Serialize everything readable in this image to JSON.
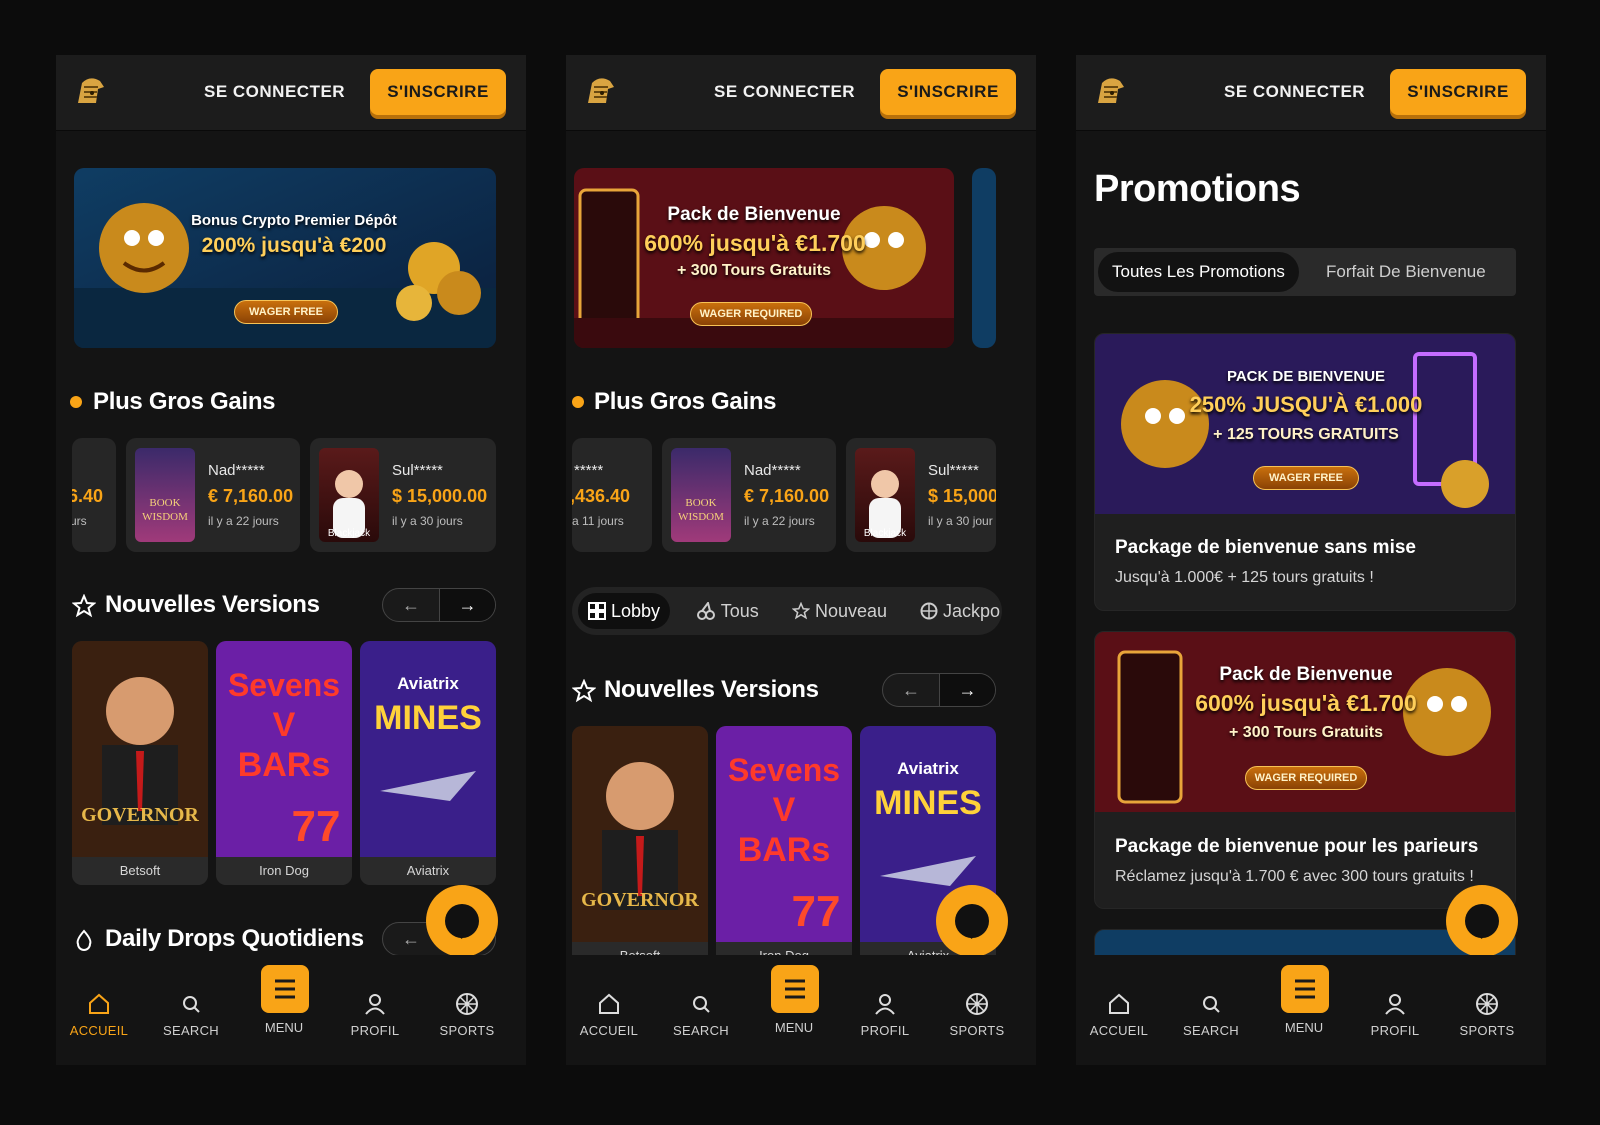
{
  "header": {
    "login_label": "SE CONNECTER",
    "signup_label": "S'INSCRIRE"
  },
  "banners": {
    "crypto": {
      "title": "Bonus Crypto Premier Dépôt",
      "line": "200% jusqu'à €200",
      "pill": "WAGER FREE"
    },
    "welcome": {
      "title": "Pack de Bienvenue",
      "line": "600% jusqu'à €1.700",
      "sub": "+ 300 Tours Gratuits",
      "pill": "WAGER REQUIRED"
    }
  },
  "biggest_wins": {
    "title": "Plus Gros Gains",
    "panel1": [
      {
        "user": "",
        "amount": "6.40",
        "time": "urs",
        "thumb": ""
      },
      {
        "user": "Nad*****",
        "amount": "€ 7,160.00",
        "time": "il y a 22 jours",
        "thumb": "Book of Wisdom"
      },
      {
        "user": "Sul*****",
        "amount": "$ 15,000.00",
        "time": "il y a 30 jours",
        "thumb": "Blackjack"
      }
    ],
    "panel2": [
      {
        "user": "*****",
        "amount": ",436.40",
        "time": "a 11 jours",
        "thumb": ""
      },
      {
        "user": "Nad*****",
        "amount": "€ 7,160.00",
        "time": "il y a 22 jours",
        "thumb": "Book of Wisdom"
      },
      {
        "user": "Sul*****",
        "amount": "$ 15,000",
        "time": "il y a 30 jour",
        "thumb": "Blackjack"
      }
    ]
  },
  "new_releases": {
    "title": "Nouvelles Versions",
    "prev_icon": "←",
    "next_icon": "→",
    "games": [
      {
        "name": "Betsoft",
        "art": "THE GOVERNOR"
      },
      {
        "name": "Iron Dog",
        "art": "Sevens V BARs"
      },
      {
        "name": "Aviatrix",
        "art": "Aviatrix MINES"
      }
    ]
  },
  "daily_drops": {
    "title": "Daily Drops Quotidiens"
  },
  "lobby_tabs": [
    {
      "label": "Lobby",
      "icon": "grid-icon"
    },
    {
      "label": "Tous",
      "icon": "cherries-icon"
    },
    {
      "label": "Nouveau",
      "icon": "star-icon"
    },
    {
      "label": "Jackpo",
      "icon": "coin-icon"
    }
  ],
  "promotions": {
    "title": "Promotions",
    "tabs": [
      "Toutes Les Promotions",
      "Forfait De Bienvenue"
    ],
    "cards": [
      {
        "banner_title": "PACK DE BIENVENUE",
        "banner_line": "250% JUSQU'À €1.000",
        "banner_sub": "+ 125 TOURS GRATUITS",
        "pill": "WAGER FREE",
        "name": "Package de bienvenue sans mise",
        "desc": "Jusqu'à 1.000€ + 125 tours gratuits !"
      },
      {
        "banner_title": "Pack de Bienvenue",
        "banner_line": "600% jusqu'à €1.700",
        "banner_sub": "+ 300 Tours Gratuits",
        "pill": "WAGER REQUIRED",
        "name": "Package de bienvenue pour les parieurs",
        "desc": "Réclamez jusqu'à 1.700 € avec 300 tours gratuits !"
      }
    ]
  },
  "bottom_nav": [
    {
      "label": "ACCUEIL",
      "icon": "home-icon"
    },
    {
      "label": "SEARCH",
      "icon": "search-icon"
    },
    {
      "label": "MENU",
      "icon": "menu-icon"
    },
    {
      "label": "PROFIL",
      "icon": "user-icon"
    },
    {
      "label": "SPORTS",
      "icon": "ball-icon"
    }
  ],
  "colors": {
    "accent": "#f9a417",
    "background": "#141414",
    "card": "#262626"
  }
}
